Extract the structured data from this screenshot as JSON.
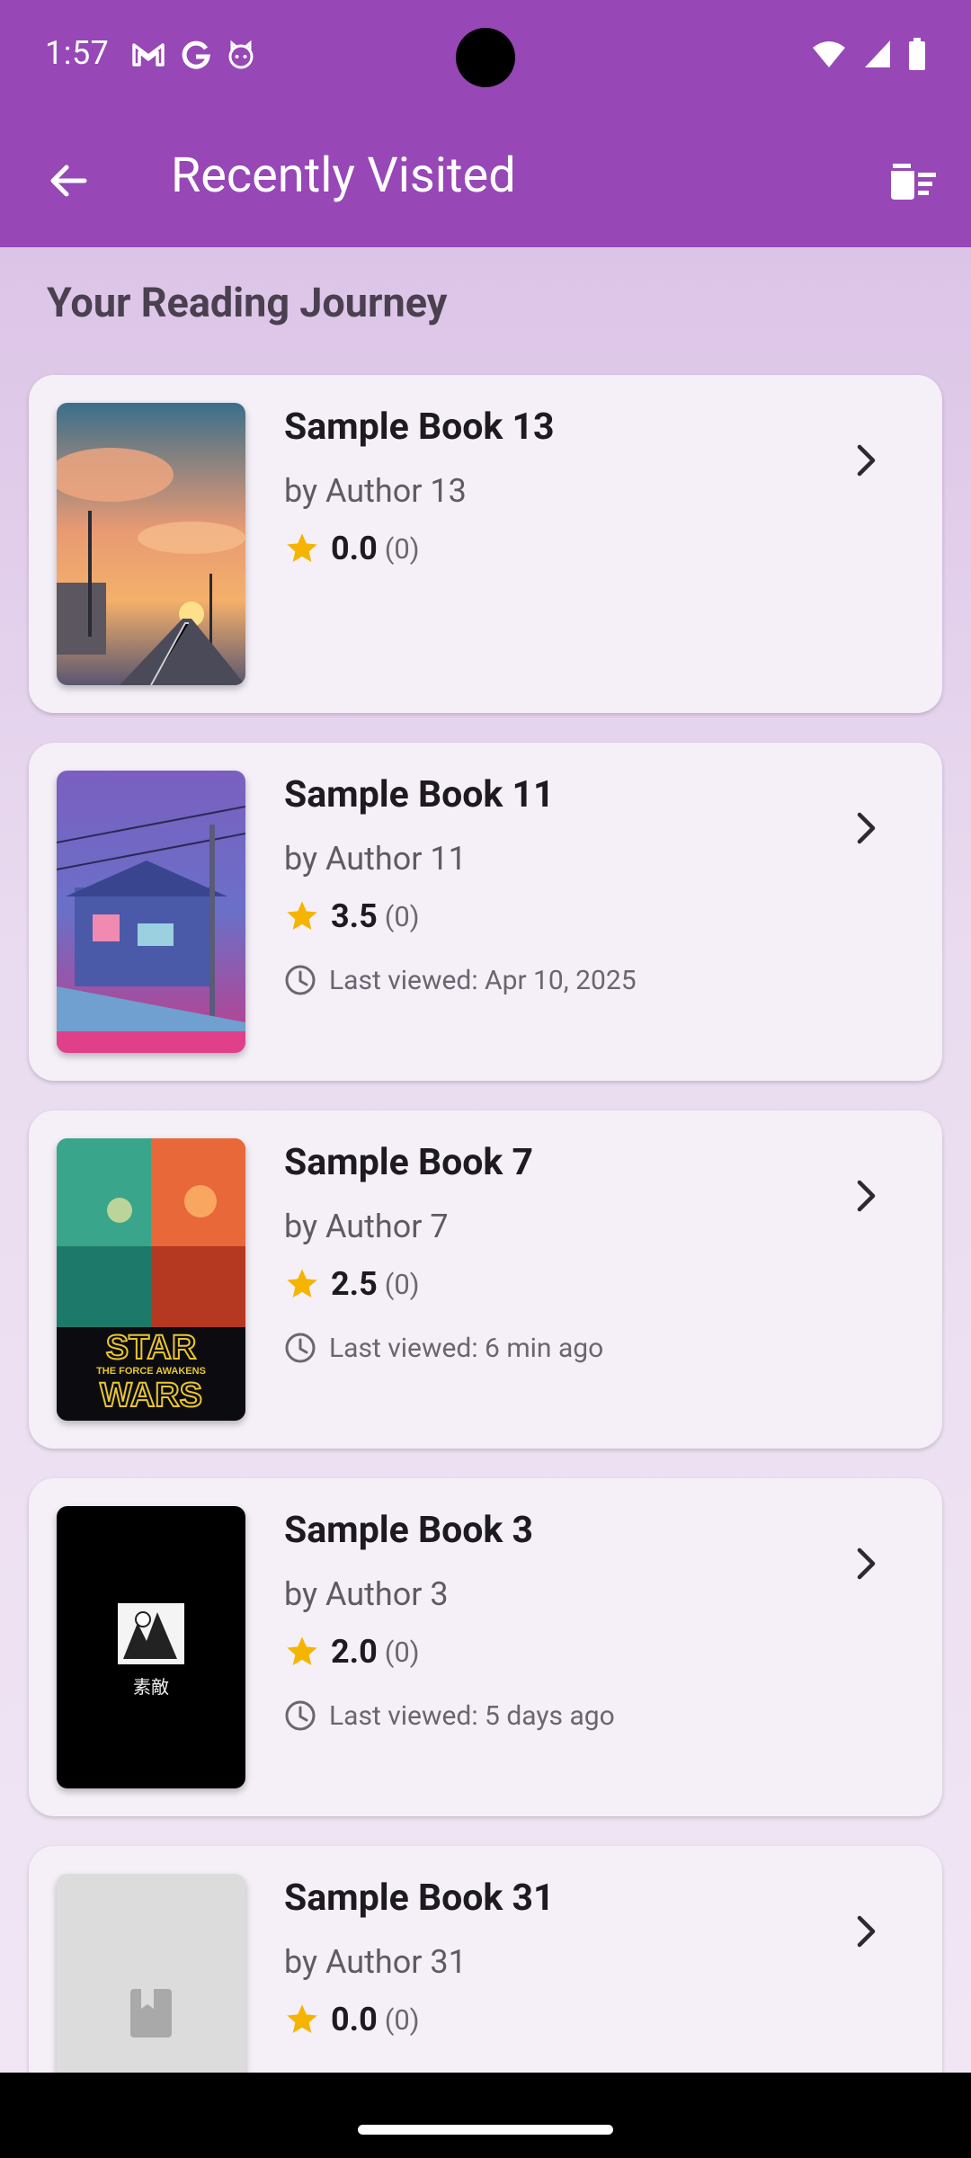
{
  "status_bar": {
    "time": "1:57",
    "left_icons": [
      "gmail-icon",
      "google-icon",
      "cat-face-icon"
    ],
    "right_icons": [
      "wifi-icon",
      "signal-icon",
      "battery-icon"
    ]
  },
  "app_bar": {
    "title": "Recently Visited",
    "back_icon": "arrow-back-icon",
    "action_icon": "delete-sweep-icon",
    "color": "#9747b6"
  },
  "section_title": "Your Reading Journey",
  "books": [
    {
      "title": "Sample Book 13",
      "author": "by Author 13",
      "rating": "0.0",
      "count": "(0)",
      "last_viewed": null,
      "cover": "sunset-street"
    },
    {
      "title": "Sample Book 11",
      "author": "by Author 11",
      "rating": "3.5",
      "count": "(0)",
      "last_viewed": "Last viewed: Apr 10, 2025",
      "cover": "purple-city"
    },
    {
      "title": "Sample Book 7",
      "author": "by Author 7",
      "rating": "2.5",
      "count": "(0)",
      "last_viewed": "Last viewed: 6 min ago",
      "cover": "star-wars",
      "cover_text": [
        "STAR",
        "THE FORCE AWAKENS",
        "WARS"
      ]
    },
    {
      "title": "Sample Book 3",
      "author": "by Author 3",
      "rating": "2.0",
      "count": "(0)",
      "last_viewed": "Last viewed: 5 days ago",
      "cover": "black-manga",
      "cover_text": [
        "素敵"
      ]
    },
    {
      "title": "Sample Book 31",
      "author": "by Author 31",
      "rating": "0.0",
      "count": "(0)",
      "last_viewed": null,
      "cover": "placeholder-book-icon"
    }
  ],
  "colors": {
    "star": "#f5b400",
    "card": "#f5eff7",
    "background": "#dcc3e6"
  }
}
